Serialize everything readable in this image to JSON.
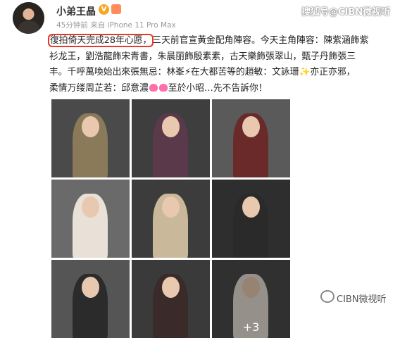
{
  "post": {
    "username": "小弟王晶",
    "verified_glyph": "V",
    "meta": "45分钟前 来自 iPhone 11 Pro Max",
    "lines": [
      {
        "highlight": "復拍倚天完成28年心愿，",
        "rest": "三天前官宣黃金配角陣容。今天主角陣容：陳紫涵飾紫"
      },
      {
        "text": "衫龙王，劉浩龍飾宋青書，朱晨丽飾殷素素，古天樂飾張翠山，甄子丹飾張三"
      },
      {
        "text": "丰。千呼萬喚始出來張無忌：林峯⚡在大都苦等的趙敏：文詠珊✨亦正亦邪，"
      },
      {
        "pre": "柔情万缕周芷若：邱意濃",
        "post": "至於小昭…先不告訴你！"
      }
    ]
  },
  "header_watermark": "搜狐号@CIBN微视听",
  "grid": {
    "more_label": "+3",
    "photos": [
      {
        "bg": "#4a4a4a",
        "color": "#8a7a5a"
      },
      {
        "bg": "#3e3e3e",
        "color": "#5a3a4a"
      },
      {
        "bg": "#5a5a5a",
        "color": "#6a2a2a"
      },
      {
        "bg": "#6a6a6a",
        "color": "#e9e0d8"
      },
      {
        "bg": "#3c3c3c",
        "color": "#c9b99a"
      },
      {
        "bg": "#2e2e2e",
        "color": "#2a2a2a"
      },
      {
        "bg": "#555555",
        "color": "#2b2b2b"
      },
      {
        "bg": "#3a3a3a",
        "color": "#3a2a2a"
      },
      {
        "bg": "#4a4a4a",
        "color": "#e6ddd6"
      }
    ]
  },
  "footer_watermark": "CIBN微视听"
}
